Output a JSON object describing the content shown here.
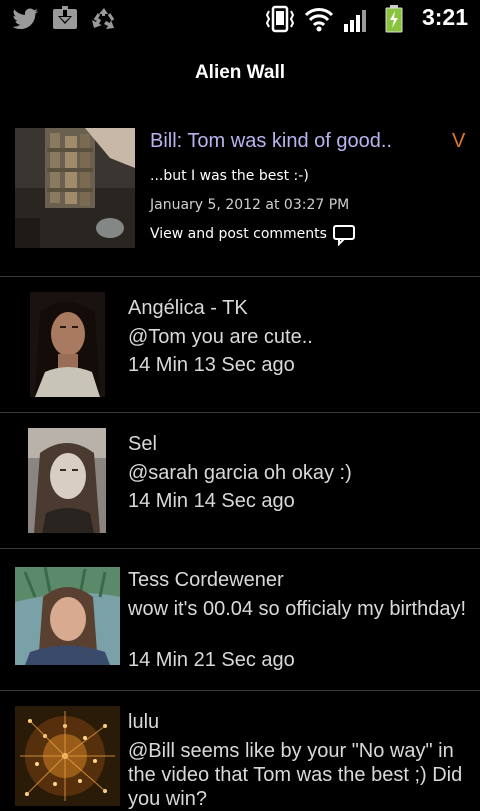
{
  "status_bar": {
    "time": "3:21",
    "icons": [
      "twitter-icon",
      "download-icon",
      "recycle-icon",
      "vibrate-icon",
      "wifi-icon",
      "signal-icon",
      "battery-charging-icon"
    ]
  },
  "header": {
    "title": "Alien Wall"
  },
  "featured": {
    "title": "Bill: Tom was kind of good..",
    "trailing_letter": "V",
    "subtitle": "...but I was the best :-)",
    "date": "January 5, 2012 at 03:27 PM",
    "comments_link": "View and post comments"
  },
  "posts": [
    {
      "name": "Angélica - TK",
      "message": "@Tom you are cute..",
      "time": "14 Min 13 Sec ago"
    },
    {
      "name": "Sel",
      "message": "@sarah garcia oh okay :)",
      "time": "14 Min 14 Sec ago"
    },
    {
      "name": "Tess Cordewener",
      "message": "wow it's 00.04  so officialy my birthday!",
      "time": "14 Min 21 Sec ago"
    },
    {
      "name": "lulu",
      "message": "@Bill seems like by your \"No way\" in the video that Tom was the best ;) Did you win?",
      "time": ""
    }
  ],
  "colors": {
    "background": "#000000",
    "featured_title": "#b8b4ee",
    "accent_orange": "#e0782e",
    "battery_green": "#8ac43f"
  }
}
